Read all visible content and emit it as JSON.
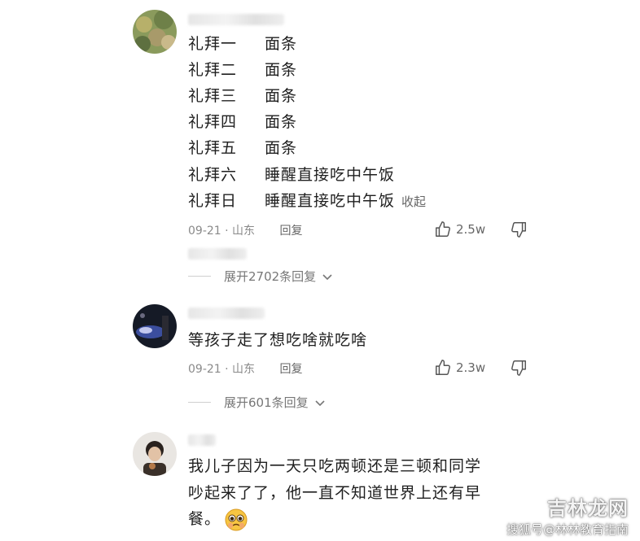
{
  "comments": [
    {
      "lines": [
        {
          "day": "礼拜一",
          "food": "面条"
        },
        {
          "day": "礼拜二",
          "food": "面条"
        },
        {
          "day": "礼拜三",
          "food": "面条"
        },
        {
          "day": "礼拜四",
          "food": "面条"
        },
        {
          "day": "礼拜五",
          "food": "面条"
        },
        {
          "day": "礼拜六",
          "food": "睡醒直接吃中午饭"
        },
        {
          "day": "礼拜日",
          "food": "睡醒直接吃中午饭"
        }
      ],
      "collapse_label": "收起",
      "date": "09-21",
      "separator": "·",
      "location": "山东",
      "reply_label": "回复",
      "likes": "2.5w",
      "expand_label": "展开2702条回复"
    },
    {
      "text": "等孩子走了想吃啥就吃啥",
      "date": "09-21",
      "separator": "·",
      "location": "山东",
      "reply_label": "回复",
      "likes": "2.3w",
      "expand_label": "展开601条回复"
    },
    {
      "text_line1": "我儿子因为一天只吃两顿还是三顿和同学",
      "text_line2": "吵起来了了，他一直不知道世界上还有早",
      "text_line3": "餐。"
    }
  ],
  "watermark": {
    "brand": "吉林龙网",
    "sub": "搜狐号@林林教育指南"
  },
  "colors": {
    "accent": "#e84c4c",
    "meta_gray": "#8a8a8a"
  }
}
